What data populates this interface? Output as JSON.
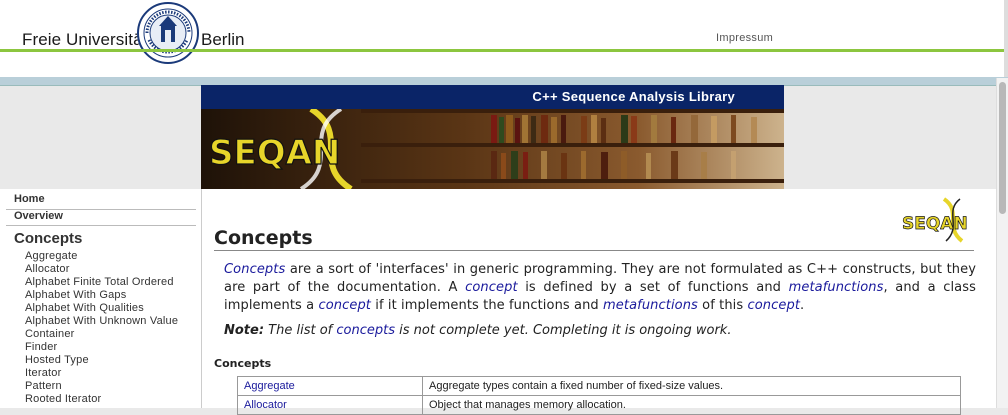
{
  "header": {
    "university_left": "Freie Universität",
    "university_right": "Berlin",
    "impressum": "Impressum",
    "seal_text": "VERITAS IUSTITIA LIBERTAS · FREIE UNIVERSITÄT BERLIN",
    "accent_green": "#8cc63f"
  },
  "banner": {
    "title": "C++ Sequence Analysis Library",
    "logo_text": "SEQAN",
    "bg_color": "#0a2467"
  },
  "sidebar": {
    "home": "Home",
    "overview": "Overview",
    "section": "Concepts",
    "items": [
      "Aggregate",
      "Allocator",
      "Alphabet Finite Total Ordered",
      "Alphabet With Gaps",
      "Alphabet With Qualities",
      "Alphabet With Unknown Value",
      "Container",
      "Finder",
      "Hosted Type",
      "Iterator",
      "Pattern",
      "Rooted Iterator"
    ]
  },
  "main": {
    "title": "Concepts",
    "logo_text": "SEQAN",
    "intro": {
      "p1_link": "Concepts",
      "p1_a": " are a sort of 'interfaces' in generic programming. They are not formulated as C++ constructs, but they are part of the documentation. A ",
      "p1_link2": "concept",
      "p1_b": " is defined by a set of functions and ",
      "p1_link3": "metafunctions",
      "p1_c": ", and a class implements a ",
      "p1_link4": "concept",
      "p1_d": " if it implements the functions and ",
      "p1_link5": "metafunctions",
      "p1_e": " of this ",
      "p1_link6": "concept",
      "p1_f": "."
    },
    "note": {
      "label": "Note:",
      "a": " The list of ",
      "link": "concepts",
      "b": " is not complete yet. Completing it is ongoing work."
    },
    "table_heading": "Concepts",
    "table_rows": [
      {
        "name": "Aggregate",
        "desc": "Aggregate types contain a fixed number of fixed-size values."
      },
      {
        "name": "Allocator",
        "desc": "Object that manages memory allocation."
      }
    ]
  }
}
